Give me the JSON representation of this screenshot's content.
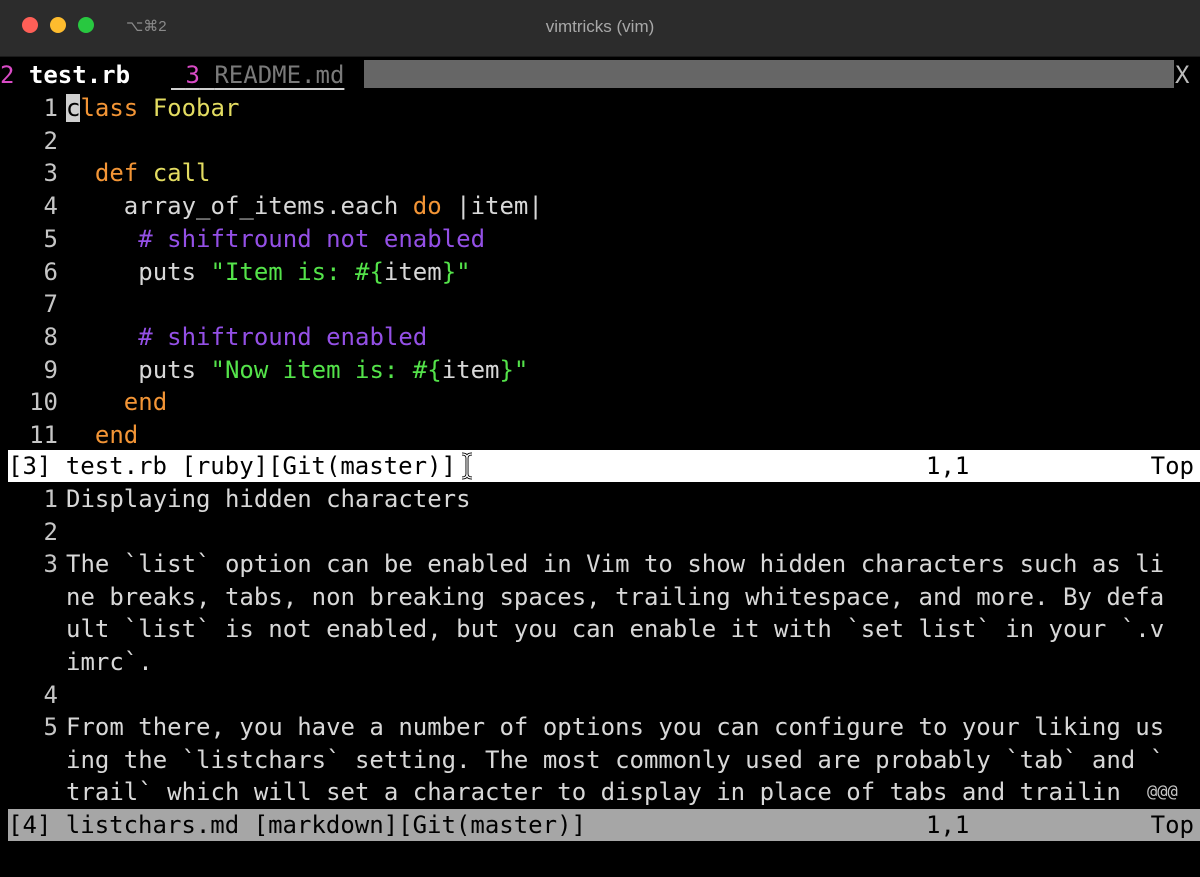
{
  "window": {
    "title": "vimtricks (vim)",
    "shortcut": "⌥⌘2"
  },
  "tabline": {
    "active_tab": {
      "number": "2",
      "name": "test.rb"
    },
    "inactive_tab": {
      "number": "3",
      "name": "README.md"
    },
    "close_label": "X"
  },
  "top_pane": {
    "lines": [
      {
        "n": "1",
        "tokens": [
          {
            "t": "c",
            "k": "cursor"
          },
          {
            "t": "lass ",
            "k": "kw"
          },
          {
            "t": "Foobar",
            "k": "ident"
          }
        ]
      },
      {
        "n": "2",
        "tokens": []
      },
      {
        "n": "3",
        "tokens": [
          {
            "t": "  ",
            "k": "plain"
          },
          {
            "t": "def ",
            "k": "kw"
          },
          {
            "t": "call",
            "k": "ident"
          }
        ]
      },
      {
        "n": "4",
        "tokens": [
          {
            "t": "    array_of_items.each ",
            "k": "plain"
          },
          {
            "t": "do",
            "k": "kw"
          },
          {
            "t": " |item|",
            "k": "plain"
          }
        ]
      },
      {
        "n": "5",
        "tokens": [
          {
            "t": "     ",
            "k": "plain"
          },
          {
            "t": "# shiftround not enabled",
            "k": "cm"
          }
        ]
      },
      {
        "n": "6",
        "tokens": [
          {
            "t": "     puts ",
            "k": "plain"
          },
          {
            "t": "\"Item is: #{",
            "k": "str"
          },
          {
            "t": "item",
            "k": "plain"
          },
          {
            "t": "}\"",
            "k": "str"
          }
        ]
      },
      {
        "n": "7",
        "tokens": []
      },
      {
        "n": "8",
        "tokens": [
          {
            "t": "     ",
            "k": "plain"
          },
          {
            "t": "# shiftround enabled",
            "k": "cm"
          }
        ]
      },
      {
        "n": "9",
        "tokens": [
          {
            "t": "     puts ",
            "k": "plain"
          },
          {
            "t": "\"Now item is: #{",
            "k": "str"
          },
          {
            "t": "item",
            "k": "plain"
          },
          {
            "t": "}\"",
            "k": "str"
          }
        ]
      },
      {
        "n": "10",
        "tokens": [
          {
            "t": "    ",
            "k": "plain"
          },
          {
            "t": "end",
            "k": "kw"
          }
        ]
      },
      {
        "n": "11",
        "tokens": [
          {
            "t": "  ",
            "k": "plain"
          },
          {
            "t": "end",
            "k": "kw"
          }
        ]
      }
    ],
    "status": {
      "left": "[3] test.rb [ruby][Git(master)]",
      "position": "1,1",
      "scroll": "Top"
    }
  },
  "bottom_pane": {
    "lines": [
      {
        "n": "1",
        "text": "Displaying hidden characters"
      },
      {
        "n": "2",
        "text": ""
      },
      {
        "n": "3",
        "text": "The `list` option can be enabled in Vim to show hidden characters such as li"
      },
      {
        "n": "",
        "text": "ne breaks, tabs, non breaking spaces, trailing whitespace, and more. By defa"
      },
      {
        "n": "",
        "text": "ult `list` is not enabled, but you can enable it with `set list` in your `.v"
      },
      {
        "n": "",
        "text": "imrc`."
      },
      {
        "n": "4",
        "text": ""
      },
      {
        "n": "5",
        "text": "From there, you have a number of options you can configure to your liking us"
      },
      {
        "n": "",
        "text": "ing the `listchars` setting. The most commonly used are probably `tab` and `"
      },
      {
        "n": "",
        "text": "trail` which will set a character to display in place of tabs and trailin"
      }
    ],
    "wrap_marker": "@@@",
    "status": {
      "left": "[4] listchars.md [markdown][Git(master)]",
      "position": "1,1",
      "scroll": "Top"
    }
  }
}
